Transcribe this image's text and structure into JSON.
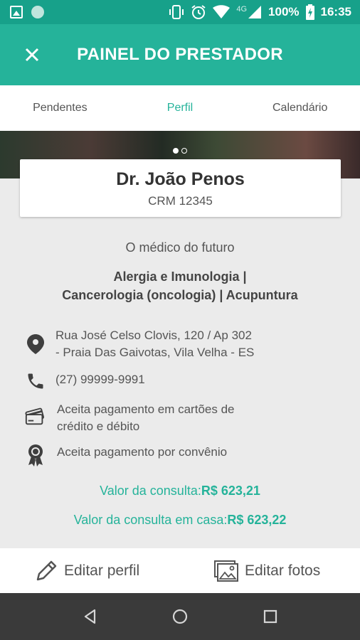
{
  "status_bar": {
    "network": "4G",
    "battery": "100%",
    "time": "16:35"
  },
  "app_bar": {
    "title": "PAINEL DO PRESTADOR"
  },
  "tabs": [
    {
      "label": "Pendentes",
      "active": false
    },
    {
      "label": "Perfil",
      "active": true
    },
    {
      "label": "Calendário",
      "active": false
    }
  ],
  "profile": {
    "name": "Dr. João Penos",
    "crm": "CRM 12345",
    "bio": "O médico do futuro",
    "specialties_line1": "Alergia e Imunologia |",
    "specialties_line2": "Cancerologia (oncologia) | Acupuntura",
    "address_line1": "Rua José Celso Clovis, 120 / Ap 302",
    "address_line2": "- Praia Das Gaivotas, Vila Velha - ES",
    "phone": "(27) 99999-9991",
    "card_payment_line1": "Aceita pagamento em cartões de",
    "card_payment_line2": "crédito e débito",
    "insurance_payment": "Aceita pagamento por convênio",
    "price_label": "Valor da consulta:",
    "price_value": "R$ 623,21",
    "home_price_label": "Valor da consulta em casa:",
    "home_price_value": "R$ 623,22"
  },
  "actions": {
    "edit_profile": "Editar perfil",
    "edit_photos": "Editar fotos"
  },
  "colors": {
    "primary": "#25b39a",
    "status_bar": "#17a18a"
  }
}
